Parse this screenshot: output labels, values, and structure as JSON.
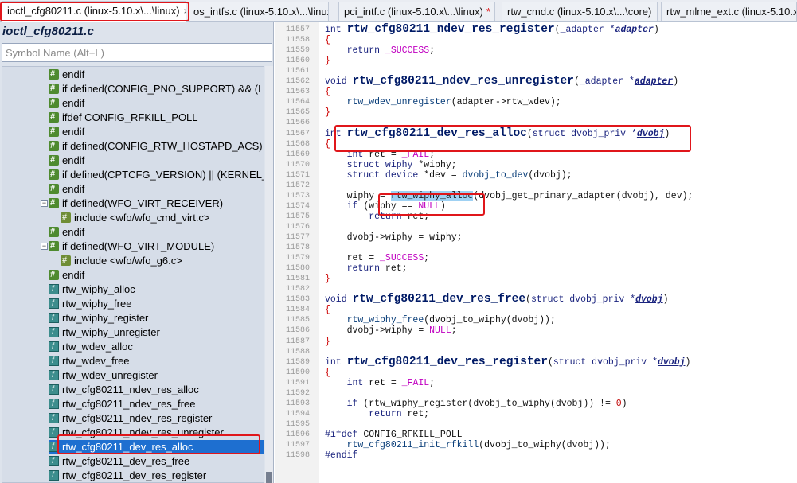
{
  "tabs": [
    {
      "label": "ioctl_cfg80211.c (linux-5.10.x\\...\\linux)",
      "active": true,
      "close": "×"
    },
    {
      "label": "os_intfs.c (linux-5.10.x\\...\\linux)",
      "active": false
    },
    {
      "label": "pci_intf.c (linux-5.10.x\\...\\linux)",
      "active": false,
      "modified": "*"
    },
    {
      "label": "rtw_cmd.c (linux-5.10.x\\...\\core)",
      "active": false
    },
    {
      "label": "rtw_mlme_ext.c (linux-5.10.x\\",
      "active": false
    }
  ],
  "symbol_panel": {
    "title": "ioctl_cfg80211.c",
    "search_placeholder": "Symbol Name (Alt+L)",
    "items": [
      {
        "label": "endif",
        "icon": "directive-icon"
      },
      {
        "label": "if defined(CONFIG_PNO_SUPPORT) && (LI",
        "icon": "directive-icon"
      },
      {
        "label": "endif",
        "icon": "directive-icon"
      },
      {
        "label": "ifdef CONFIG_RFKILL_POLL",
        "icon": "directive-icon"
      },
      {
        "label": "endif",
        "icon": "directive-icon"
      },
      {
        "label": "if defined(CONFIG_RTW_HOSTAPD_ACS) &",
        "icon": "directive-icon"
      },
      {
        "label": "endif",
        "icon": "directive-icon"
      },
      {
        "label": "if defined(CPTCFG_VERSION) || (KERNEL_VI",
        "icon": "directive-icon"
      },
      {
        "label": "endif",
        "icon": "directive-icon"
      },
      {
        "label": "if defined(WFO_VIRT_RECEIVER)",
        "icon": "directive-icon",
        "expanded": true
      },
      {
        "label": "include <wfo/wfo_cmd_virt.c>",
        "icon": "include-icon",
        "child": true
      },
      {
        "label": "endif",
        "icon": "directive-icon"
      },
      {
        "label": "if defined(WFO_VIRT_MODULE)",
        "icon": "directive-icon",
        "expanded": true
      },
      {
        "label": "include <wfo/wfo_g6.c>",
        "icon": "include-icon",
        "child": true
      },
      {
        "label": "endif",
        "icon": "directive-icon"
      },
      {
        "label": "rtw_wiphy_alloc",
        "icon": "function-icon"
      },
      {
        "label": "rtw_wiphy_free",
        "icon": "function-icon"
      },
      {
        "label": "rtw_wiphy_register",
        "icon": "function-icon"
      },
      {
        "label": "rtw_wiphy_unregister",
        "icon": "function-icon"
      },
      {
        "label": "rtw_wdev_alloc",
        "icon": "function-icon"
      },
      {
        "label": "rtw_wdev_free",
        "icon": "function-icon"
      },
      {
        "label": "rtw_wdev_unregister",
        "icon": "function-icon"
      },
      {
        "label": "rtw_cfg80211_ndev_res_alloc",
        "icon": "function-icon"
      },
      {
        "label": "rtw_cfg80211_ndev_res_free",
        "icon": "function-icon"
      },
      {
        "label": "rtw_cfg80211_ndev_res_register",
        "icon": "function-icon"
      },
      {
        "label": "rtw_cfg80211_ndev_res_unregister",
        "icon": "function-icon"
      },
      {
        "label": "rtw_cfg80211_dev_res_alloc",
        "icon": "function-icon",
        "selected": true
      },
      {
        "label": "rtw_cfg80211_dev_res_free",
        "icon": "function-icon"
      },
      {
        "label": "rtw_cfg80211_dev_res_register",
        "icon": "function-icon"
      }
    ]
  },
  "editor": {
    "lines": [
      {
        "n": "11557",
        "parts": [
          [
            "kw",
            "int "
          ],
          [
            "fnname",
            "rtw_cfg80211_ndev_res_register"
          ],
          [
            "var",
            "("
          ],
          [
            "ty",
            "_adapter *"
          ],
          [
            "param",
            "adapter"
          ],
          [
            "var",
            ")"
          ]
        ]
      },
      {
        "n": "11558",
        "parts": [
          [
            "brace",
            "{"
          ]
        ]
      },
      {
        "n": "11559",
        "parts": [
          [
            "kw",
            "    return "
          ],
          [
            "macro",
            "_SUCCESS"
          ],
          [
            "var",
            ";"
          ]
        ]
      },
      {
        "n": "11560",
        "parts": [
          [
            "brace",
            "}"
          ]
        ]
      },
      {
        "n": "11561",
        "parts": []
      },
      {
        "n": "11562",
        "parts": [
          [
            "kw",
            "void "
          ],
          [
            "fnname",
            "rtw_cfg80211_ndev_res_unregister"
          ],
          [
            "var",
            "("
          ],
          [
            "ty",
            "_adapter *"
          ],
          [
            "param",
            "adapter"
          ],
          [
            "var",
            ")"
          ]
        ]
      },
      {
        "n": "11563",
        "parts": [
          [
            "brace",
            "{"
          ]
        ]
      },
      {
        "n": "11564",
        "parts": [
          [
            "call",
            "    rtw_wdev_unregister"
          ],
          [
            "var",
            "(adapter->rtw_wdev);"
          ]
        ]
      },
      {
        "n": "11565",
        "parts": [
          [
            "brace",
            "}"
          ]
        ]
      },
      {
        "n": "11566",
        "parts": []
      },
      {
        "n": "11567",
        "parts": [
          [
            "kw",
            "int "
          ],
          [
            "fnname",
            "rtw_cfg80211_dev_res_alloc"
          ],
          [
            "var",
            "("
          ],
          [
            "ty",
            "struct dvobj_priv *"
          ],
          [
            "param",
            "dvobj"
          ],
          [
            "var",
            ")"
          ]
        ]
      },
      {
        "n": "11568",
        "parts": [
          [
            "brace",
            "{"
          ]
        ]
      },
      {
        "n": "11569",
        "parts": [
          [
            "kw",
            "    int "
          ],
          [
            "var",
            "ret = "
          ],
          [
            "macro",
            "_FAIL"
          ],
          [
            "var",
            ";"
          ]
        ]
      },
      {
        "n": "11570",
        "parts": [
          [
            "kw",
            "    struct "
          ],
          [
            "ty",
            "wiphy "
          ],
          [
            "var",
            "*wiphy;"
          ]
        ]
      },
      {
        "n": "11571",
        "parts": [
          [
            "kw",
            "    struct "
          ],
          [
            "ty",
            "device "
          ],
          [
            "var",
            "*dev = "
          ],
          [
            "call",
            "dvobj_to_dev"
          ],
          [
            "var",
            "(dvobj);"
          ]
        ]
      },
      {
        "n": "11572",
        "parts": []
      },
      {
        "n": "11573",
        "parts": [
          [
            "var",
            "    wiphy = "
          ],
          [
            "sel",
            "rtw_wiphy_alloc"
          ],
          [
            "var",
            "(dvobj_get_primary_adapter(dvobj), dev);"
          ]
        ]
      },
      {
        "n": "11574",
        "parts": [
          [
            "kw",
            "    if "
          ],
          [
            "var",
            "(wiphy == "
          ],
          [
            "macro",
            "NULL"
          ],
          [
            "var",
            ")"
          ]
        ]
      },
      {
        "n": "11575",
        "parts": [
          [
            "kw",
            "        return "
          ],
          [
            "var",
            "ret;"
          ]
        ]
      },
      {
        "n": "11576",
        "parts": []
      },
      {
        "n": "11577",
        "parts": [
          [
            "var",
            "    dvobj->wiphy = wiphy;"
          ]
        ]
      },
      {
        "n": "11578",
        "parts": []
      },
      {
        "n": "11579",
        "parts": [
          [
            "var",
            "    ret = "
          ],
          [
            "macro",
            "_SUCCESS"
          ],
          [
            "var",
            ";"
          ]
        ]
      },
      {
        "n": "11580",
        "parts": [
          [
            "kw",
            "    return "
          ],
          [
            "var",
            "ret;"
          ]
        ]
      },
      {
        "n": "11581",
        "parts": [
          [
            "brace",
            "}"
          ]
        ]
      },
      {
        "n": "11582",
        "parts": []
      },
      {
        "n": "11583",
        "parts": [
          [
            "kw",
            "void "
          ],
          [
            "fnname",
            "rtw_cfg80211_dev_res_free"
          ],
          [
            "var",
            "("
          ],
          [
            "ty",
            "struct dvobj_priv *"
          ],
          [
            "param",
            "dvobj"
          ],
          [
            "var",
            ")"
          ]
        ]
      },
      {
        "n": "11584",
        "parts": [
          [
            "brace",
            "{"
          ]
        ]
      },
      {
        "n": "11585",
        "parts": [
          [
            "call",
            "    rtw_wiphy_free"
          ],
          [
            "var",
            "(dvobj_to_wiphy(dvobj));"
          ]
        ]
      },
      {
        "n": "11586",
        "parts": [
          [
            "var",
            "    dvobj->wiphy = "
          ],
          [
            "macro",
            "NULL"
          ],
          [
            "var",
            ";"
          ]
        ]
      },
      {
        "n": "11587",
        "parts": [
          [
            "brace",
            "}"
          ]
        ]
      },
      {
        "n": "11588",
        "parts": []
      },
      {
        "n": "11589",
        "parts": [
          [
            "kw",
            "int "
          ],
          [
            "fnname",
            "rtw_cfg80211_dev_res_register"
          ],
          [
            "var",
            "("
          ],
          [
            "ty",
            "struct dvobj_priv *"
          ],
          [
            "param",
            "dvobj"
          ],
          [
            "var",
            ")"
          ]
        ]
      },
      {
        "n": "11590",
        "parts": [
          [
            "brace",
            "{"
          ]
        ]
      },
      {
        "n": "11591",
        "parts": [
          [
            "kw",
            "    int "
          ],
          [
            "var",
            "ret = "
          ],
          [
            "macro",
            "_FAIL"
          ],
          [
            "var",
            ";"
          ]
        ]
      },
      {
        "n": "11592",
        "parts": []
      },
      {
        "n": "11593",
        "parts": [
          [
            "kw",
            "    if "
          ],
          [
            "var",
            "(rtw_wiphy_register(dvobj_to_wiphy(dvobj)) != "
          ],
          [
            "num",
            "0"
          ],
          [
            "var",
            ")"
          ]
        ]
      },
      {
        "n": "11594",
        "parts": [
          [
            "kw",
            "        return "
          ],
          [
            "var",
            "ret;"
          ]
        ]
      },
      {
        "n": "11595",
        "parts": []
      },
      {
        "n": "11596",
        "parts": [
          [
            "kw",
            "#ifdef "
          ],
          [
            "var",
            "CONFIG_RFKILL_POLL"
          ]
        ]
      },
      {
        "n": "11597",
        "parts": [
          [
            "call",
            "    rtw_cfg80211_init_rfkill"
          ],
          [
            "var",
            "(dvobj_to_wiphy(dvobj));"
          ]
        ]
      },
      {
        "n": "11598",
        "parts": [
          [
            "kw",
            "#endif"
          ]
        ]
      }
    ]
  }
}
